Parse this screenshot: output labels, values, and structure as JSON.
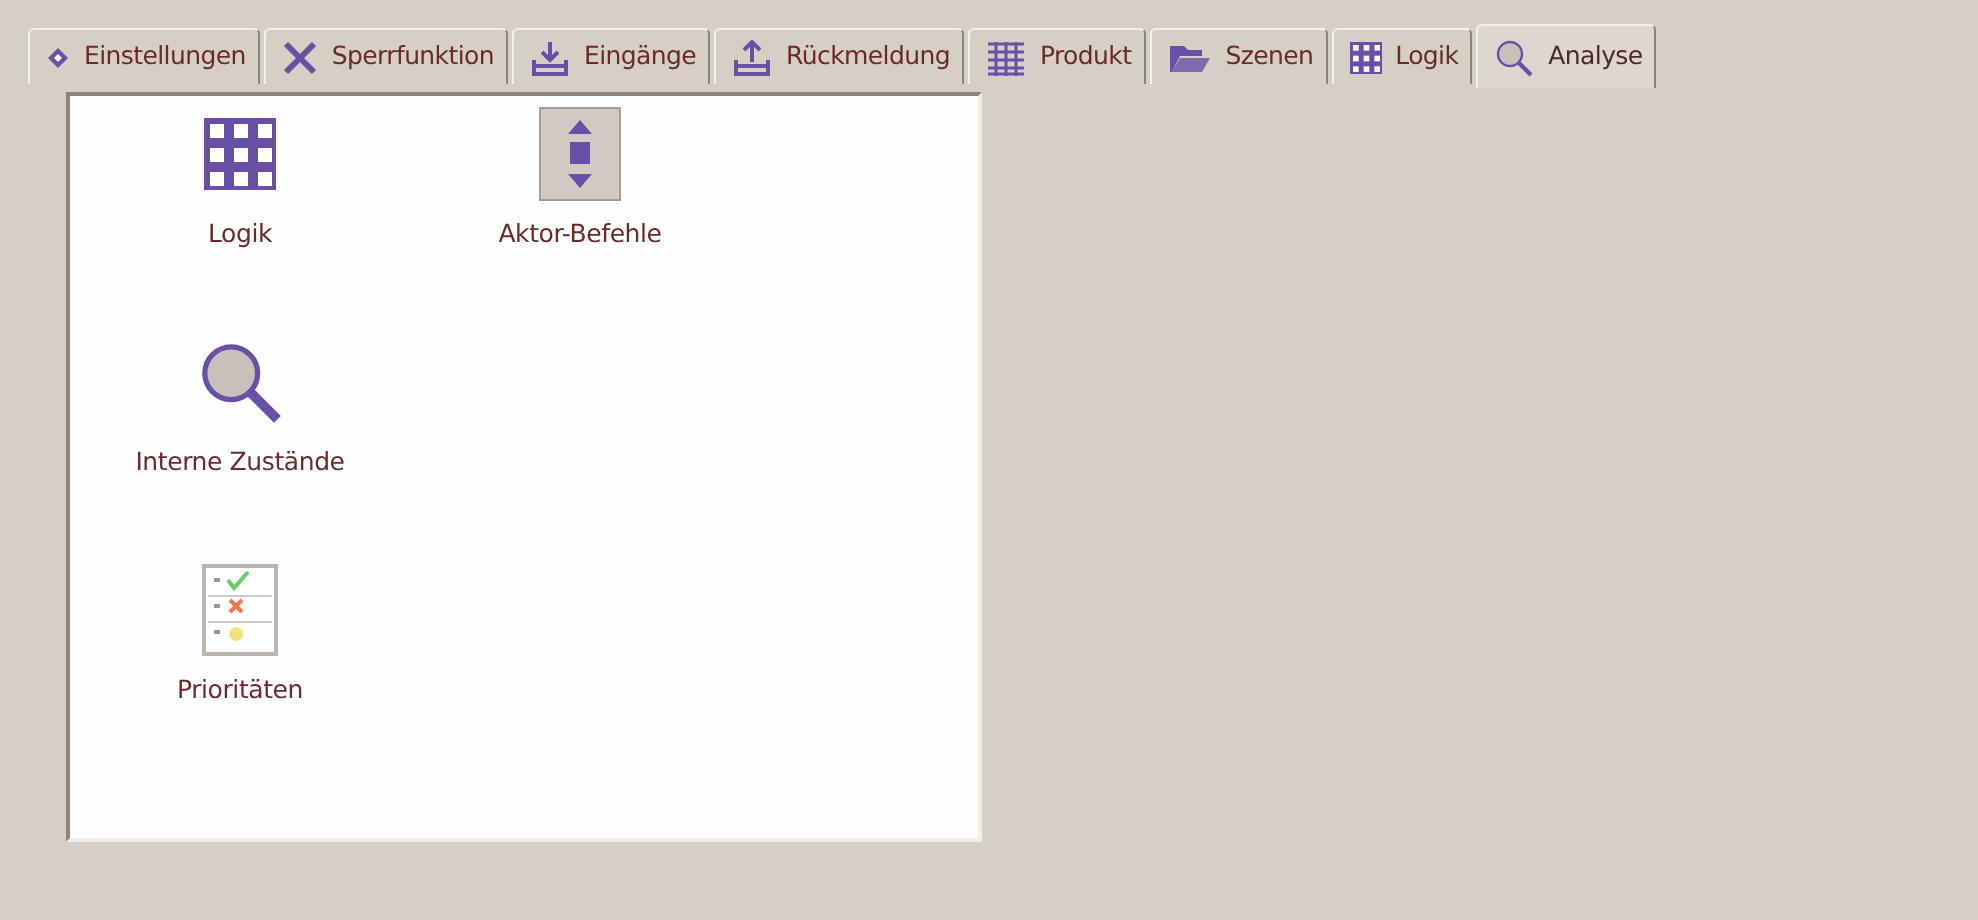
{
  "tabs": [
    {
      "label": "Einstellungen",
      "kind": "diamond",
      "selected": false
    },
    {
      "label": "Sperrfunktion",
      "kind": "cross",
      "selected": false
    },
    {
      "label": "Eingänge",
      "kind": "import",
      "selected": false
    },
    {
      "label": "Rückmeldung",
      "kind": "export",
      "selected": false
    },
    {
      "label": "Produkt",
      "kind": "mesh",
      "selected": false
    },
    {
      "label": "Szenen",
      "kind": "folder",
      "selected": false
    },
    {
      "label": "Logik",
      "kind": "grid",
      "selected": false
    },
    {
      "label": "Analyse",
      "kind": "magnifier",
      "selected": true
    }
  ],
  "items": [
    [
      {
        "label": "Logik",
        "kind": "grid"
      },
      {
        "label": "Aktor-Befehle",
        "kind": "updown"
      }
    ],
    [
      {
        "label": "Interne Zustände",
        "kind": "magnifier"
      }
    ],
    [
      {
        "label": "Prioritäten",
        "kind": "checklist"
      }
    ]
  ]
}
